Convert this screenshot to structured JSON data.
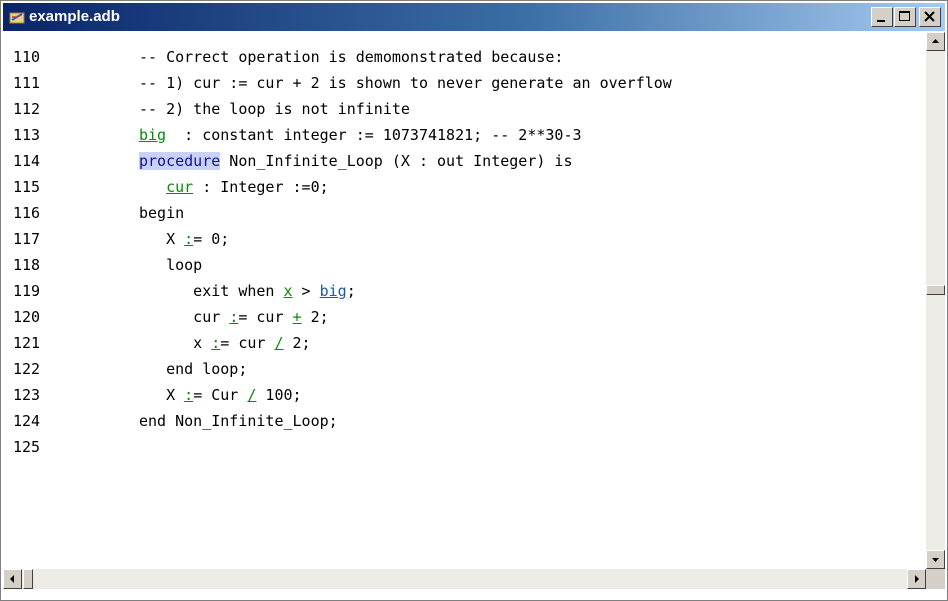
{
  "window": {
    "title": "example.adb",
    "icons": {
      "title": "ada-file-icon",
      "minimize": "minimize-icon",
      "maximize": "maximize-icon",
      "close": "close-icon"
    }
  },
  "colors": {
    "title_gradient_start": "#0a246a",
    "title_gradient_end": "#a6caf0",
    "identifier_green": "#0a8a0a",
    "reference_blue": "#1a5aa0",
    "keyword_highlight": "#c9d2f5"
  },
  "editor": {
    "lines": [
      {
        "num": "110",
        "segments": [
          {
            "t": "-- Correct operation is demomonstrated because:"
          }
        ]
      },
      {
        "num": "111",
        "segments": [
          {
            "t": "-- 1) cur := cur + 2 is shown to never generate an overflow"
          }
        ]
      },
      {
        "num": "112",
        "segments": [
          {
            "t": "-- 2) the loop is not infinite"
          }
        ]
      },
      {
        "num": "113",
        "segments": [
          {
            "t": "big",
            "s": "green"
          },
          {
            "t": "  : constant integer := 1073741821; -- 2**30-3"
          }
        ]
      },
      {
        "num": "114",
        "segments": [
          {
            "t": "procedure",
            "s": "kw"
          },
          {
            "t": " Non_Infinite_Loop (X : out Integer) is"
          }
        ]
      },
      {
        "num": "115",
        "segments": [
          {
            "t": "   "
          },
          {
            "t": "cur",
            "s": "green"
          },
          {
            "t": " : Integer :=0;"
          }
        ]
      },
      {
        "num": "116",
        "segments": [
          {
            "t": "begin"
          }
        ]
      },
      {
        "num": "117",
        "segments": [
          {
            "t": "   X "
          },
          {
            "t": ":",
            "s": "green"
          },
          {
            "t": "= 0;"
          }
        ]
      },
      {
        "num": "118",
        "segments": [
          {
            "t": "   loop"
          }
        ]
      },
      {
        "num": "119",
        "segments": [
          {
            "t": "      exit when "
          },
          {
            "t": "x",
            "s": "green"
          },
          {
            "t": " > "
          },
          {
            "t": "big",
            "s": "blue"
          },
          {
            "t": ";"
          }
        ]
      },
      {
        "num": "120",
        "segments": [
          {
            "t": "      cur "
          },
          {
            "t": ":",
            "s": "green"
          },
          {
            "t": "= cur "
          },
          {
            "t": "+",
            "s": "green"
          },
          {
            "t": " 2;"
          }
        ]
      },
      {
        "num": "121",
        "segments": [
          {
            "t": "      x "
          },
          {
            "t": ":",
            "s": "green"
          },
          {
            "t": "= cur "
          },
          {
            "t": "/",
            "s": "green"
          },
          {
            "t": " 2;"
          }
        ]
      },
      {
        "num": "122",
        "segments": [
          {
            "t": "   end loop;"
          }
        ]
      },
      {
        "num": "123",
        "segments": [
          {
            "t": "   X "
          },
          {
            "t": ":",
            "s": "green"
          },
          {
            "t": "= Cur "
          },
          {
            "t": "/",
            "s": "green"
          },
          {
            "t": " 100;"
          }
        ]
      },
      {
        "num": "124",
        "segments": [
          {
            "t": "end Non_Infinite_Loop;"
          }
        ]
      },
      {
        "num": "125",
        "segments": []
      }
    ]
  },
  "scrollbars": {
    "icons": {
      "up": "scroll-up-arrow-icon",
      "down": "scroll-down-arrow-icon",
      "left": "scroll-left-arrow-icon",
      "right": "scroll-right-arrow-icon"
    }
  }
}
